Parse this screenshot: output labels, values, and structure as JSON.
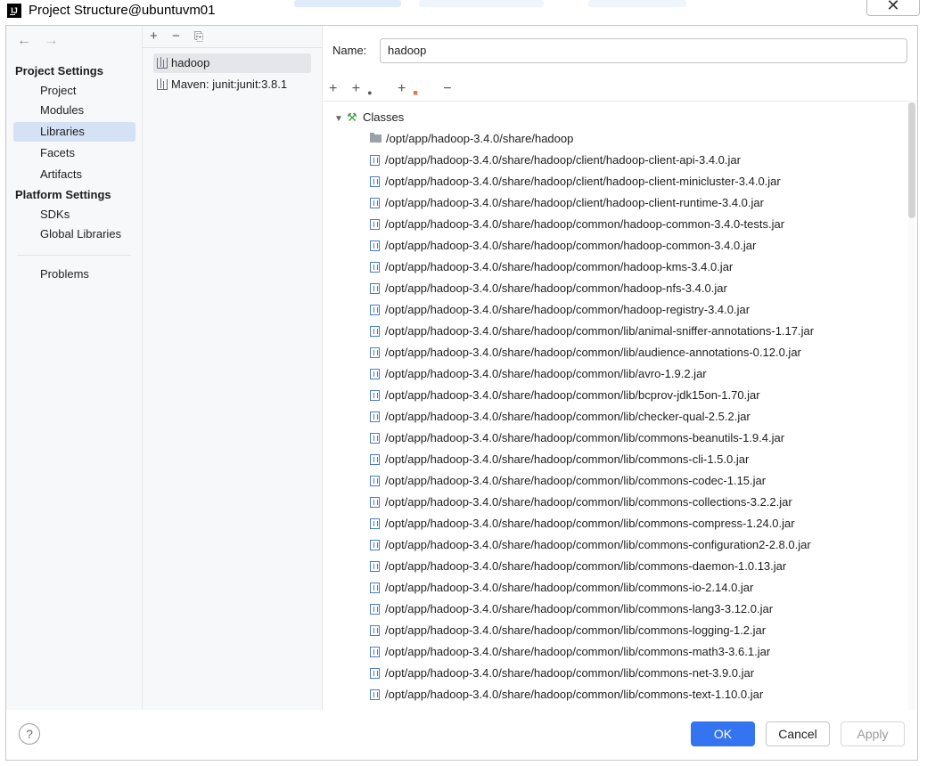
{
  "window": {
    "title": "Project Structure@ubuntuvm01",
    "logo_text": "IJ",
    "close_glyph": "✕"
  },
  "nav": {
    "back_icon": "←",
    "forward_icon": "→",
    "project_settings_header": "Project Settings",
    "project_settings_items": [
      {
        "label": "Project",
        "selected": false
      },
      {
        "label": "Modules",
        "selected": false
      },
      {
        "label": "Libraries",
        "selected": true
      },
      {
        "label": "Facets",
        "selected": false
      },
      {
        "label": "Artifacts",
        "selected": false
      }
    ],
    "platform_settings_header": "Platform Settings",
    "platform_settings_items": [
      {
        "label": "SDKs"
      },
      {
        "label": "Global Libraries"
      }
    ],
    "problems_label": "Problems"
  },
  "libraries": {
    "toolbar": {
      "add": "+",
      "remove": "−",
      "copy": "⎘"
    },
    "items": [
      {
        "label": "hadoop",
        "selected": true
      },
      {
        "label": "Maven: junit:junit:3.8.1",
        "selected": false
      }
    ]
  },
  "detail": {
    "name_label": "Name:",
    "name_value": "hadoop",
    "toolbar": {
      "add": "+",
      "add_spec": "+",
      "add_other": "+",
      "remove": "−"
    },
    "classes_label": "Classes",
    "class_roots": [
      {
        "type": "folder",
        "path": "/opt/app/hadoop-3.4.0/share/hadoop"
      },
      {
        "type": "jar",
        "path": "/opt/app/hadoop-3.4.0/share/hadoop/client/hadoop-client-api-3.4.0.jar"
      },
      {
        "type": "jar",
        "path": "/opt/app/hadoop-3.4.0/share/hadoop/client/hadoop-client-minicluster-3.4.0.jar"
      },
      {
        "type": "jar",
        "path": "/opt/app/hadoop-3.4.0/share/hadoop/client/hadoop-client-runtime-3.4.0.jar"
      },
      {
        "type": "jar",
        "path": "/opt/app/hadoop-3.4.0/share/hadoop/common/hadoop-common-3.4.0-tests.jar"
      },
      {
        "type": "jar",
        "path": "/opt/app/hadoop-3.4.0/share/hadoop/common/hadoop-common-3.4.0.jar"
      },
      {
        "type": "jar",
        "path": "/opt/app/hadoop-3.4.0/share/hadoop/common/hadoop-kms-3.4.0.jar"
      },
      {
        "type": "jar",
        "path": "/opt/app/hadoop-3.4.0/share/hadoop/common/hadoop-nfs-3.4.0.jar"
      },
      {
        "type": "jar",
        "path": "/opt/app/hadoop-3.4.0/share/hadoop/common/hadoop-registry-3.4.0.jar"
      },
      {
        "type": "jar",
        "path": "/opt/app/hadoop-3.4.0/share/hadoop/common/lib/animal-sniffer-annotations-1.17.jar"
      },
      {
        "type": "jar",
        "path": "/opt/app/hadoop-3.4.0/share/hadoop/common/lib/audience-annotations-0.12.0.jar"
      },
      {
        "type": "jar",
        "path": "/opt/app/hadoop-3.4.0/share/hadoop/common/lib/avro-1.9.2.jar"
      },
      {
        "type": "jar",
        "path": "/opt/app/hadoop-3.4.0/share/hadoop/common/lib/bcprov-jdk15on-1.70.jar"
      },
      {
        "type": "jar",
        "path": "/opt/app/hadoop-3.4.0/share/hadoop/common/lib/checker-qual-2.5.2.jar"
      },
      {
        "type": "jar",
        "path": "/opt/app/hadoop-3.4.0/share/hadoop/common/lib/commons-beanutils-1.9.4.jar"
      },
      {
        "type": "jar",
        "path": "/opt/app/hadoop-3.4.0/share/hadoop/common/lib/commons-cli-1.5.0.jar"
      },
      {
        "type": "jar",
        "path": "/opt/app/hadoop-3.4.0/share/hadoop/common/lib/commons-codec-1.15.jar"
      },
      {
        "type": "jar",
        "path": "/opt/app/hadoop-3.4.0/share/hadoop/common/lib/commons-collections-3.2.2.jar"
      },
      {
        "type": "jar",
        "path": "/opt/app/hadoop-3.4.0/share/hadoop/common/lib/commons-compress-1.24.0.jar"
      },
      {
        "type": "jar",
        "path": "/opt/app/hadoop-3.4.0/share/hadoop/common/lib/commons-configuration2-2.8.0.jar"
      },
      {
        "type": "jar",
        "path": "/opt/app/hadoop-3.4.0/share/hadoop/common/lib/commons-daemon-1.0.13.jar"
      },
      {
        "type": "jar",
        "path": "/opt/app/hadoop-3.4.0/share/hadoop/common/lib/commons-io-2.14.0.jar"
      },
      {
        "type": "jar",
        "path": "/opt/app/hadoop-3.4.0/share/hadoop/common/lib/commons-lang3-3.12.0.jar"
      },
      {
        "type": "jar",
        "path": "/opt/app/hadoop-3.4.0/share/hadoop/common/lib/commons-logging-1.2.jar"
      },
      {
        "type": "jar",
        "path": "/opt/app/hadoop-3.4.0/share/hadoop/common/lib/commons-math3-3.6.1.jar"
      },
      {
        "type": "jar",
        "path": "/opt/app/hadoop-3.4.0/share/hadoop/common/lib/commons-net-3.9.0.jar"
      },
      {
        "type": "jar",
        "path": "/opt/app/hadoop-3.4.0/share/hadoop/common/lib/commons-text-1.10.0.jar"
      }
    ]
  },
  "footer": {
    "help_label": "?",
    "ok_label": "OK",
    "cancel_label": "Cancel",
    "apply_label": "Apply"
  },
  "colors": {
    "accent": "#3574f0",
    "selection": "#d5e1f5",
    "jar_icon": "#4a7cc4",
    "classes_icon": "#3d9a3d"
  }
}
